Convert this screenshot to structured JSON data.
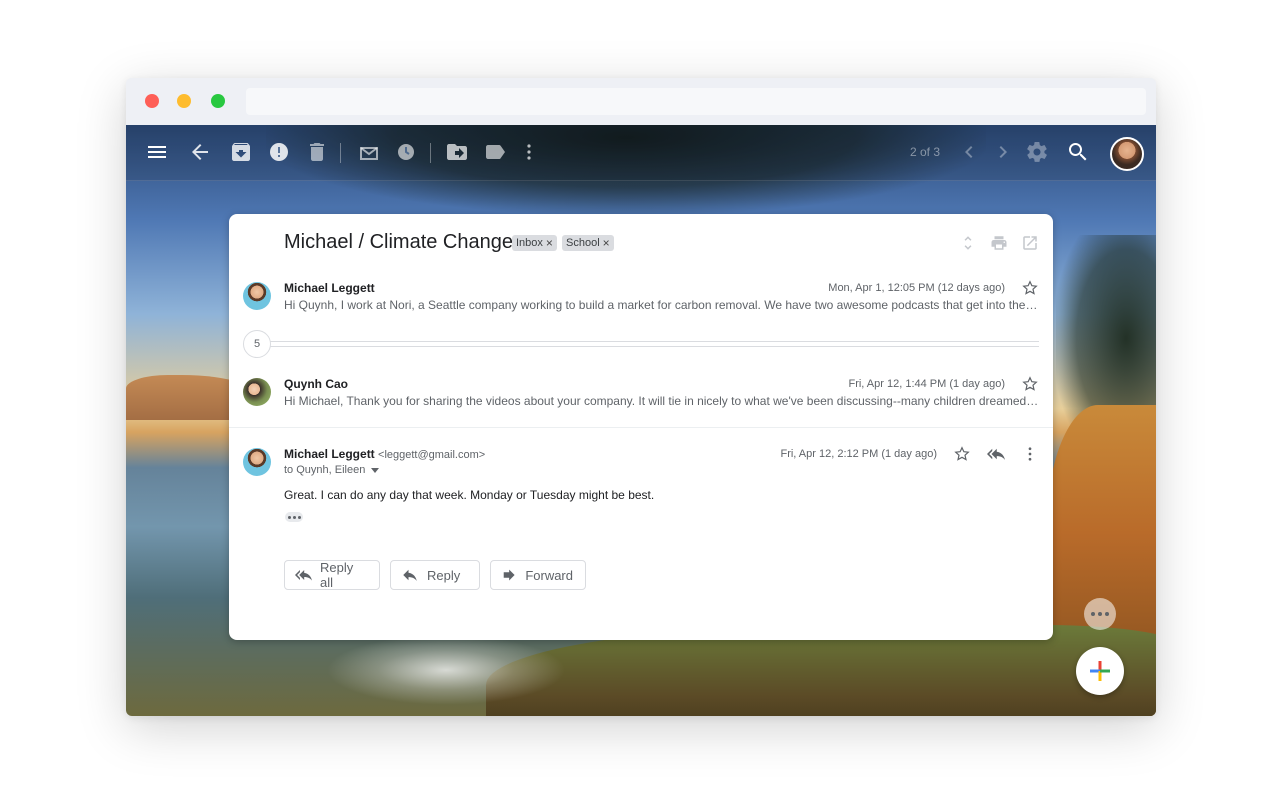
{
  "toolbar": {
    "pager": "2 of 3",
    "icons": [
      "menu-icon",
      "back-arrow-icon",
      "archive-icon",
      "report-spam-icon",
      "delete-icon",
      "mark-unread-icon",
      "snooze-icon",
      "move-to-icon",
      "label-icon",
      "more-vert-icon",
      "chevron-left-icon",
      "chevron-right-icon",
      "settings-icon",
      "search-icon",
      "avatar"
    ]
  },
  "thread": {
    "subject": "Michael / Climate Change",
    "labels": [
      "Inbox",
      "School"
    ],
    "collapsed_count": "5",
    "messages": [
      {
        "sender": "Michael Leggett",
        "date": "Mon, Apr 1, 12:05 PM (12 days ago)",
        "snippet": "Hi Quynh, I work at Nori, a Seattle company working to build a market for carbon removal. We have two awesome podcasts that get into the nitty gritty of carbon removal"
      },
      {
        "sender": "Quynh Cao",
        "date": "Fri, Apr 12, 1:44 PM (1 day ago)",
        "snippet": "Hi Michael, Thank you for sharing the videos about your company. It will tie in nicely to what we've been discussing--many children dreamed up ways to remove carbon"
      },
      {
        "sender": "Michael Leggett",
        "email": "<leggett@gmail.com>",
        "date": "Fri, Apr 12, 2:12 PM (1 day ago)",
        "to": "to Quynh, Eileen",
        "body": "Great. I can do any day that week. Monday or Tuesday might be best."
      }
    ]
  },
  "actions": {
    "reply_all": "Reply all",
    "reply": "Reply",
    "forward": "Forward"
  },
  "colors": {
    "fab_red": "#ea4335",
    "fab_blue": "#4285f4",
    "fab_yellow": "#fbbc04",
    "fab_green": "#34a853"
  }
}
